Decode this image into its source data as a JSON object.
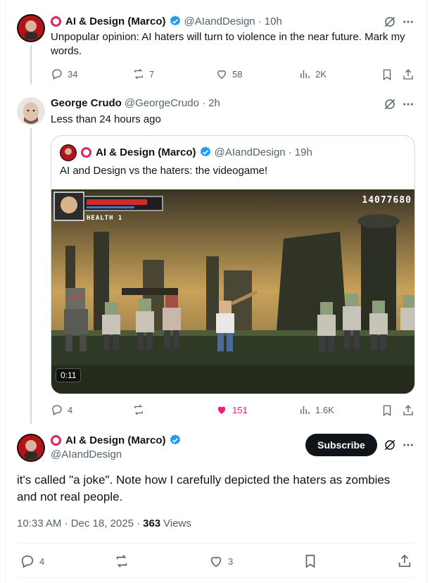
{
  "tweet1": {
    "display_name": "AI & Design (Marco)",
    "handle": "@AIandDesign",
    "time": "· 10h",
    "text": "Unpopular opinion: AI haters will turn to violence in the near future. Mark my words.",
    "replies": "34",
    "reposts": "7",
    "likes": "58",
    "views": "2K"
  },
  "tweet2": {
    "display_name": "George Crudo",
    "handle": "@GeorgeCrudo",
    "time": "· 2h",
    "text": "Less than 24 hours ago",
    "replies": "4",
    "reposts": "",
    "likes": "151",
    "views": "1.6K",
    "quote": {
      "display_name": "AI & Design (Marco)",
      "handle": "@AIandDesign",
      "time": "· 19h",
      "text": "AI and Design vs the haters: the videogame!",
      "game_health_label": "HEALTH 1",
      "game_score": "14077680",
      "video_duration": "0:11"
    }
  },
  "tweet3": {
    "display_name": "AI & Design (Marco)",
    "handle": "@AIandDesign",
    "subscribe_label": "Subscribe",
    "text": "it's called \"a joke\". Note how I carefully depicted the haters as zombies and not real people.",
    "timestamp": "10:33 AM · Dec 18, 2025 ·",
    "views_count": "363",
    "views_label": "Views",
    "replies": "4",
    "likes": "3"
  },
  "colors": {
    "text_primary": "#0f1419",
    "text_secondary": "#536471",
    "verified_blue": "#1d9bf0",
    "like_pink": "#f91880",
    "ring_red": "#e0245e"
  },
  "icons": [
    "grok-icon",
    "more-icon",
    "reply-icon",
    "repost-icon",
    "like-icon",
    "views-icon",
    "bookmark-icon",
    "share-icon",
    "verified-icon"
  ]
}
